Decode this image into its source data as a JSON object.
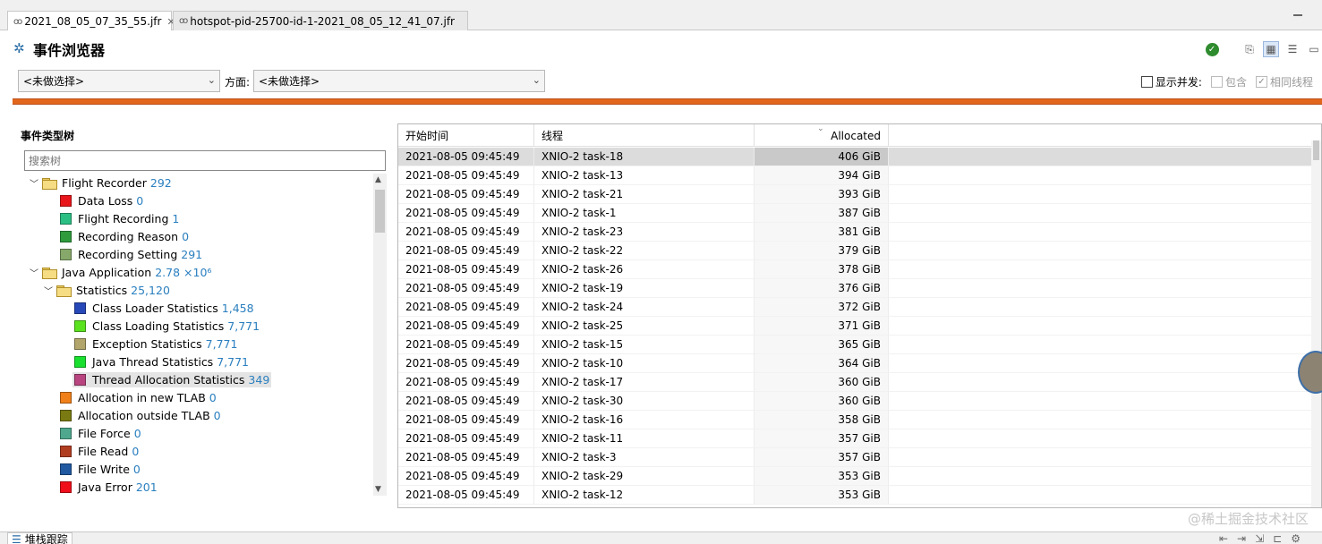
{
  "tabs": [
    {
      "label": "2021_08_05_07_35_55.jfr",
      "icon": "recording-icon",
      "active": true
    },
    {
      "label": "hotspot-pid-25700-id-1-2021_08_05_12_41_07.jfr",
      "icon": "recording-icon",
      "active": false
    }
  ],
  "header": {
    "title": "事件浏览器",
    "title_icon": "event-browser-icon"
  },
  "filter": {
    "selection_value": "<未做选择>",
    "aspect_label": "方面:",
    "aspect_value": "<未做选择>",
    "show_concurrent_label": "显示并发:",
    "contains_label": "包含",
    "same_thread_label": "相同线程"
  },
  "tree": {
    "title": "事件类型树",
    "search_placeholder": "搜索树",
    "items": [
      {
        "label": "Flight Recorder",
        "count": "292",
        "type": "folder",
        "level": 0,
        "expanded": true
      },
      {
        "label": "Data Loss",
        "count": "0",
        "type": "leaf",
        "level": 1,
        "color": "#e8151a"
      },
      {
        "label": "Flight Recording",
        "count": "1",
        "type": "leaf",
        "level": 1,
        "color": "#2bbf84"
      },
      {
        "label": "Recording Reason",
        "count": "0",
        "type": "leaf",
        "level": 1,
        "color": "#2f9b3d"
      },
      {
        "label": "Recording Setting",
        "count": "291",
        "type": "leaf",
        "level": 1,
        "color": "#86a86a"
      },
      {
        "label": "Java Application",
        "count": "2.78 ×10⁶",
        "type": "folder",
        "level": 0,
        "expanded": true
      },
      {
        "label": "Statistics",
        "count": "25,120",
        "type": "folder",
        "level": 1,
        "expanded": true
      },
      {
        "label": "Class Loader Statistics",
        "count": "1,458",
        "type": "leaf",
        "level": 2,
        "color": "#2748b8"
      },
      {
        "label": "Class Loading Statistics",
        "count": "7,771",
        "type": "leaf",
        "level": 2,
        "color": "#5be21f"
      },
      {
        "label": "Exception Statistics",
        "count": "7,771",
        "type": "leaf",
        "level": 2,
        "color": "#b3a66c"
      },
      {
        "label": "Java Thread Statistics",
        "count": "7,771",
        "type": "leaf",
        "level": 2,
        "color": "#19e02f"
      },
      {
        "label": "Thread Allocation Statistics",
        "count": "349",
        "type": "leaf",
        "level": 2,
        "color": "#b8457f",
        "selected": true
      },
      {
        "label": "Allocation in new TLAB",
        "count": "0",
        "type": "leaf",
        "level": 1,
        "color": "#f08019"
      },
      {
        "label": "Allocation outside TLAB",
        "count": "0",
        "type": "leaf",
        "level": 1,
        "color": "#7a7a12"
      },
      {
        "label": "File Force",
        "count": "0",
        "type": "leaf",
        "level": 1,
        "color": "#4fa88d"
      },
      {
        "label": "File Read",
        "count": "0",
        "type": "leaf",
        "level": 1,
        "color": "#b13d21"
      },
      {
        "label": "File Write",
        "count": "0",
        "type": "leaf",
        "level": 1,
        "color": "#2059a0"
      },
      {
        "label": "Java Error",
        "count": "201",
        "type": "leaf",
        "level": 1,
        "color": "#ef0e1a"
      }
    ]
  },
  "table": {
    "columns": [
      "开始时间",
      "线程",
      "Allocated"
    ],
    "rows": [
      [
        "2021-08-05 09:45:49",
        "XNIO-2 task-18",
        "406 GiB"
      ],
      [
        "2021-08-05 09:45:49",
        "XNIO-2 task-13",
        "394 GiB"
      ],
      [
        "2021-08-05 09:45:49",
        "XNIO-2 task-21",
        "393 GiB"
      ],
      [
        "2021-08-05 09:45:49",
        "XNIO-2 task-1",
        "387 GiB"
      ],
      [
        "2021-08-05 09:45:49",
        "XNIO-2 task-23",
        "381 GiB"
      ],
      [
        "2021-08-05 09:45:49",
        "XNIO-2 task-22",
        "379 GiB"
      ],
      [
        "2021-08-05 09:45:49",
        "XNIO-2 task-26",
        "378 GiB"
      ],
      [
        "2021-08-05 09:45:49",
        "XNIO-2 task-19",
        "376 GiB"
      ],
      [
        "2021-08-05 09:45:49",
        "XNIO-2 task-24",
        "372 GiB"
      ],
      [
        "2021-08-05 09:45:49",
        "XNIO-2 task-25",
        "371 GiB"
      ],
      [
        "2021-08-05 09:45:49",
        "XNIO-2 task-15",
        "365 GiB"
      ],
      [
        "2021-08-05 09:45:49",
        "XNIO-2 task-10",
        "364 GiB"
      ],
      [
        "2021-08-05 09:45:49",
        "XNIO-2 task-17",
        "360 GiB"
      ],
      [
        "2021-08-05 09:45:49",
        "XNIO-2 task-30",
        "360 GiB"
      ],
      [
        "2021-08-05 09:45:49",
        "XNIO-2 task-16",
        "358 GiB"
      ],
      [
        "2021-08-05 09:45:49",
        "XNIO-2 task-11",
        "357 GiB"
      ],
      [
        "2021-08-05 09:45:49",
        "XNIO-2 task-3",
        "357 GiB"
      ],
      [
        "2021-08-05 09:45:49",
        "XNIO-2 task-29",
        "353 GiB"
      ],
      [
        "2021-08-05 09:45:49",
        "XNIO-2 task-12",
        "353 GiB"
      ]
    ],
    "selected_row": 0
  },
  "bottom": {
    "tab_label": "堆栈跟踪"
  },
  "watermark": "@稀土掘金技术社区",
  "colors": {
    "accent_bar": "#e2661b",
    "link_count": "#2a7fbf",
    "selection": "#dcdcdc"
  }
}
